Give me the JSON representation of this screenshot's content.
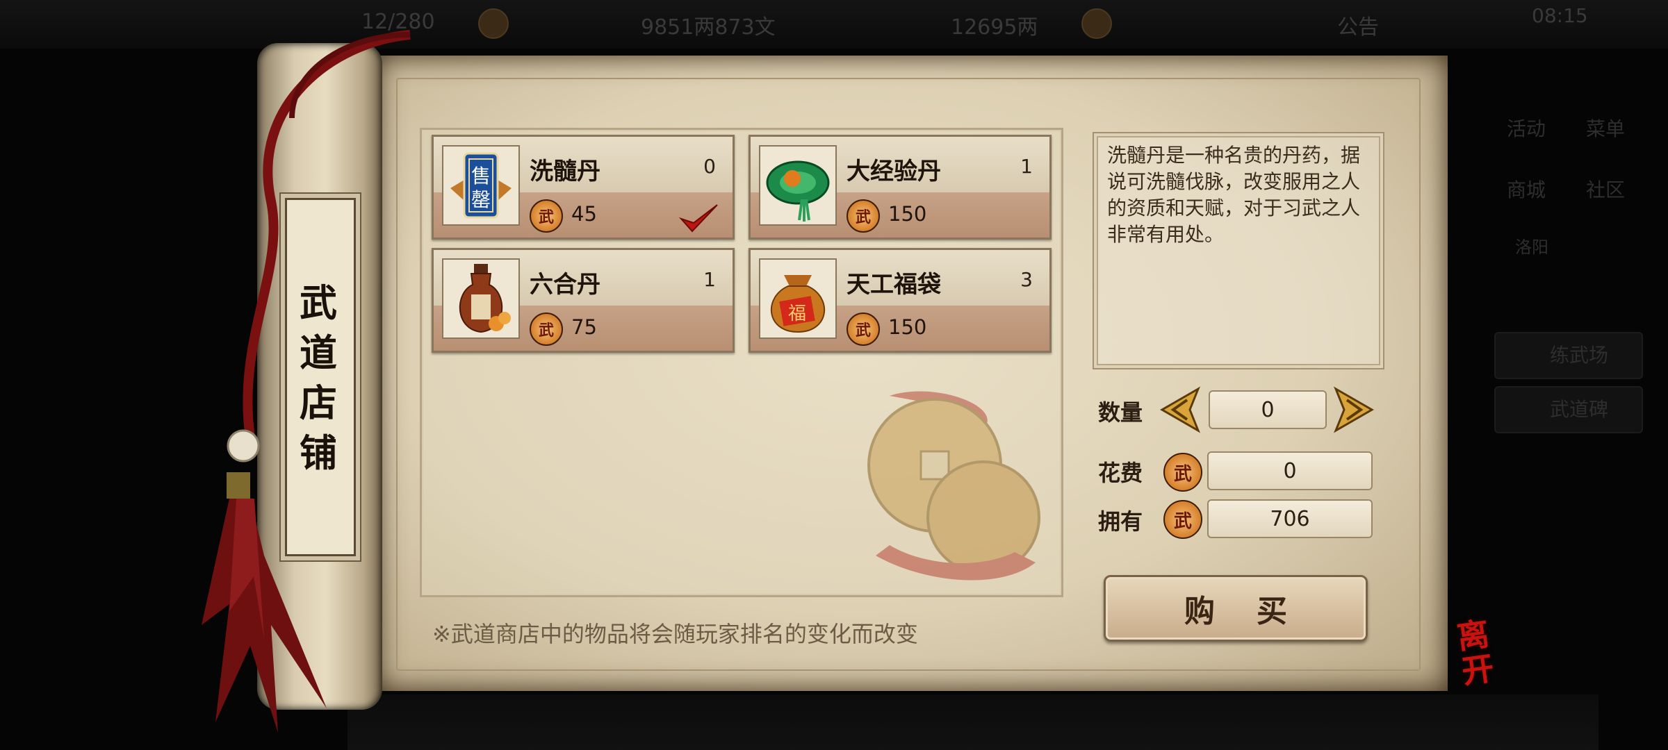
{
  "hud": {
    "stamina": "12/280",
    "silver": "9851两873文",
    "gold": "12695两",
    "notice": "公告",
    "time": "08:15",
    "side": [
      "活动",
      "菜单",
      "商城",
      "社区",
      "洛阳",
      "练武场",
      "武道碑"
    ]
  },
  "shop": {
    "title": "武道店铺",
    "currency_glyph": "武",
    "items": [
      {
        "name": "洗髓丹",
        "count": "0",
        "price": "45"
      },
      {
        "name": "大经验丹",
        "count": "1",
        "price": "150"
      },
      {
        "name": "六合丹",
        "count": "1",
        "price": "75"
      },
      {
        "name": "天工福袋",
        "count": "3",
        "price": "150"
      }
    ],
    "description": "洗髓丹是一种名贵的丹药，据说可洗髓伐脉，改变服用之人的资质和天赋，对于习武之人非常有用处。",
    "quantity_label": "数量",
    "quantity_value": "0",
    "cost_label": "花费",
    "cost_value": "0",
    "own_label": "拥有",
    "own_value": "706",
    "buy_label": "购买",
    "notice": "※武道商店中的物品将会随玩家排名的变化而改变",
    "leave_label": "离开"
  }
}
